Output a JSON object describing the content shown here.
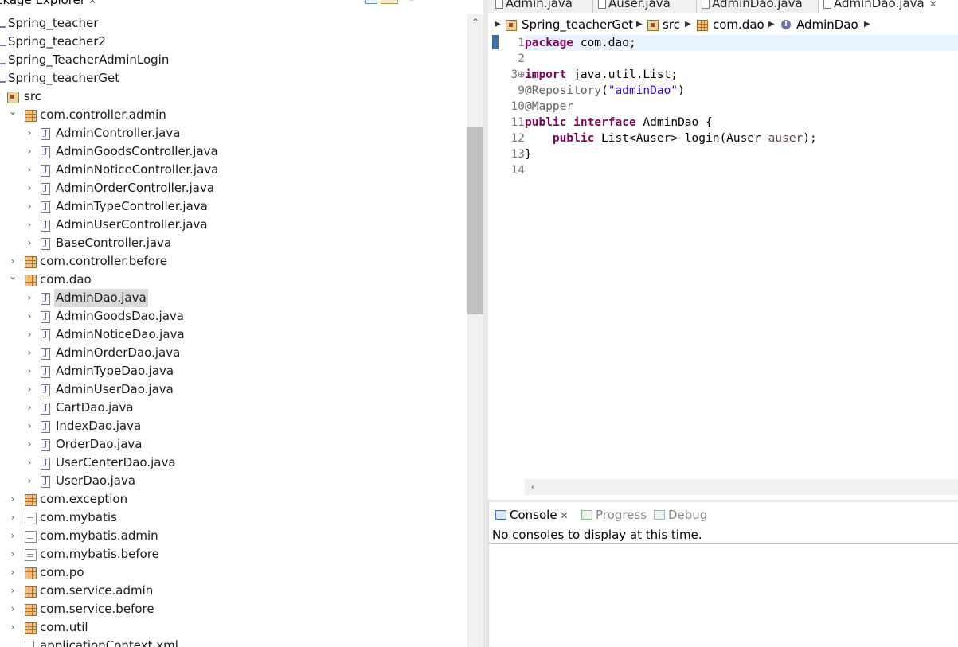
{
  "package_explorer": {
    "title": "ackage Explorer",
    "close": "✕",
    "tree": [
      {
        "label": "Spring_teacher",
        "type": "project",
        "indent": 0,
        "chev": ""
      },
      {
        "label": "Spring_teacher2",
        "type": "project",
        "indent": 0,
        "chev": ""
      },
      {
        "label": "Spring_TeacherAdminLogin",
        "type": "project",
        "indent": 0,
        "chev": ""
      },
      {
        "label": "Spring_teacherGet",
        "type": "project",
        "indent": 0,
        "chev": ""
      },
      {
        "label": "src",
        "type": "src",
        "indent": 0,
        "chev": "⌄"
      },
      {
        "label": "com.controller.admin",
        "type": "package",
        "indent": 1,
        "chev": "⌄"
      },
      {
        "label": "AdminController.java",
        "type": "java",
        "indent": 2,
        "chev": "›"
      },
      {
        "label": "AdminGoodsController.java",
        "type": "java",
        "indent": 2,
        "chev": "›"
      },
      {
        "label": "AdminNoticeController.java",
        "type": "java",
        "indent": 2,
        "chev": "›"
      },
      {
        "label": "AdminOrderController.java",
        "type": "java",
        "indent": 2,
        "chev": "›"
      },
      {
        "label": "AdminTypeController.java",
        "type": "java",
        "indent": 2,
        "chev": "›"
      },
      {
        "label": "AdminUserController.java",
        "type": "java",
        "indent": 2,
        "chev": "›"
      },
      {
        "label": "BaseController.java",
        "type": "java",
        "indent": 2,
        "chev": "›"
      },
      {
        "label": "com.controller.before",
        "type": "package",
        "indent": 1,
        "chev": "›"
      },
      {
        "label": "com.dao",
        "type": "package",
        "indent": 1,
        "chev": "⌄"
      },
      {
        "label": "AdminDao.java",
        "type": "java",
        "indent": 2,
        "chev": "›",
        "selected": true
      },
      {
        "label": "AdminGoodsDao.java",
        "type": "java",
        "indent": 2,
        "chev": "›"
      },
      {
        "label": "AdminNoticeDao.java",
        "type": "java",
        "indent": 2,
        "chev": "›"
      },
      {
        "label": "AdminOrderDao.java",
        "type": "java",
        "indent": 2,
        "chev": "›"
      },
      {
        "label": "AdminTypeDao.java",
        "type": "java",
        "indent": 2,
        "chev": "›"
      },
      {
        "label": "AdminUserDao.java",
        "type": "java",
        "indent": 2,
        "chev": "›"
      },
      {
        "label": "CartDao.java",
        "type": "java",
        "indent": 2,
        "chev": "›"
      },
      {
        "label": "IndexDao.java",
        "type": "java",
        "indent": 2,
        "chev": "›"
      },
      {
        "label": "OrderDao.java",
        "type": "java",
        "indent": 2,
        "chev": "›"
      },
      {
        "label": "UserCenterDao.java",
        "type": "java",
        "indent": 2,
        "chev": "›"
      },
      {
        "label": "UserDao.java",
        "type": "java",
        "indent": 2,
        "chev": "›"
      },
      {
        "label": "com.exception",
        "type": "package",
        "indent": 1,
        "chev": "›"
      },
      {
        "label": "com.mybatis",
        "type": "package-empty",
        "indent": 1,
        "chev": "›"
      },
      {
        "label": "com.mybatis.admin",
        "type": "package-empty",
        "indent": 1,
        "chev": "›"
      },
      {
        "label": "com.mybatis.before",
        "type": "package-empty",
        "indent": 1,
        "chev": "›"
      },
      {
        "label": "com.po",
        "type": "package",
        "indent": 1,
        "chev": "›"
      },
      {
        "label": "com.service.admin",
        "type": "package",
        "indent": 1,
        "chev": "›"
      },
      {
        "label": "com.service.before",
        "type": "package",
        "indent": 1,
        "chev": "›"
      },
      {
        "label": "com.util",
        "type": "package",
        "indent": 1,
        "chev": "›"
      },
      {
        "label": "applicationContext.xml",
        "type": "xml",
        "indent": 1,
        "chev": ""
      }
    ]
  },
  "editor": {
    "tabs": [
      {
        "label": "Admin.java",
        "active": false
      },
      {
        "label": "Auser.java",
        "active": false
      },
      {
        "label": "AdminDao.java",
        "active": false
      },
      {
        "label": "AdminDao.java",
        "active": true,
        "close": "✕"
      }
    ],
    "breadcrumb": {
      "project": "Spring_teacherGet",
      "src": "src",
      "package": "com.dao",
      "type": "AdminDao",
      "type_icon": "I"
    },
    "lines": [
      {
        "num": "1",
        "tokens": [
          [
            "kw",
            "package"
          ],
          [
            "t",
            " com.dao;"
          ]
        ]
      },
      {
        "num": "2",
        "tokens": []
      },
      {
        "num": "3⊕",
        "tokens": [
          [
            "kw",
            "import"
          ],
          [
            "t",
            " java.util.List;"
          ]
        ]
      },
      {
        "num": "9",
        "tokens": [
          [
            "ann",
            "@Repository"
          ],
          [
            "t",
            "("
          ],
          [
            "str",
            "\"adminDao\""
          ],
          [
            "t",
            ")"
          ]
        ]
      },
      {
        "num": "10",
        "tokens": [
          [
            "ann",
            "@Mapper"
          ]
        ]
      },
      {
        "num": "11",
        "tokens": [
          [
            "kw",
            "public"
          ],
          [
            "t",
            " "
          ],
          [
            "kw",
            "interface"
          ],
          [
            "t",
            " AdminDao {"
          ]
        ]
      },
      {
        "num": "12",
        "tokens": [
          [
            "t",
            "    "
          ],
          [
            "kw",
            "public"
          ],
          [
            "t",
            " List<Auser> login(Auser "
          ],
          [
            "par",
            "auser"
          ],
          [
            "t",
            ");"
          ]
        ]
      },
      {
        "num": "13",
        "tokens": [
          [
            "t",
            "}"
          ]
        ]
      },
      {
        "num": "14",
        "tokens": []
      }
    ],
    "hscroll_arrow": "‹"
  },
  "console": {
    "tabs": [
      {
        "label": "Console",
        "active": true,
        "close": "✕"
      },
      {
        "label": "Progress",
        "active": false
      },
      {
        "label": "Debug",
        "active": false
      }
    ],
    "message": "No consoles to display at this time."
  },
  "scroll_up_arrow": "⌃"
}
